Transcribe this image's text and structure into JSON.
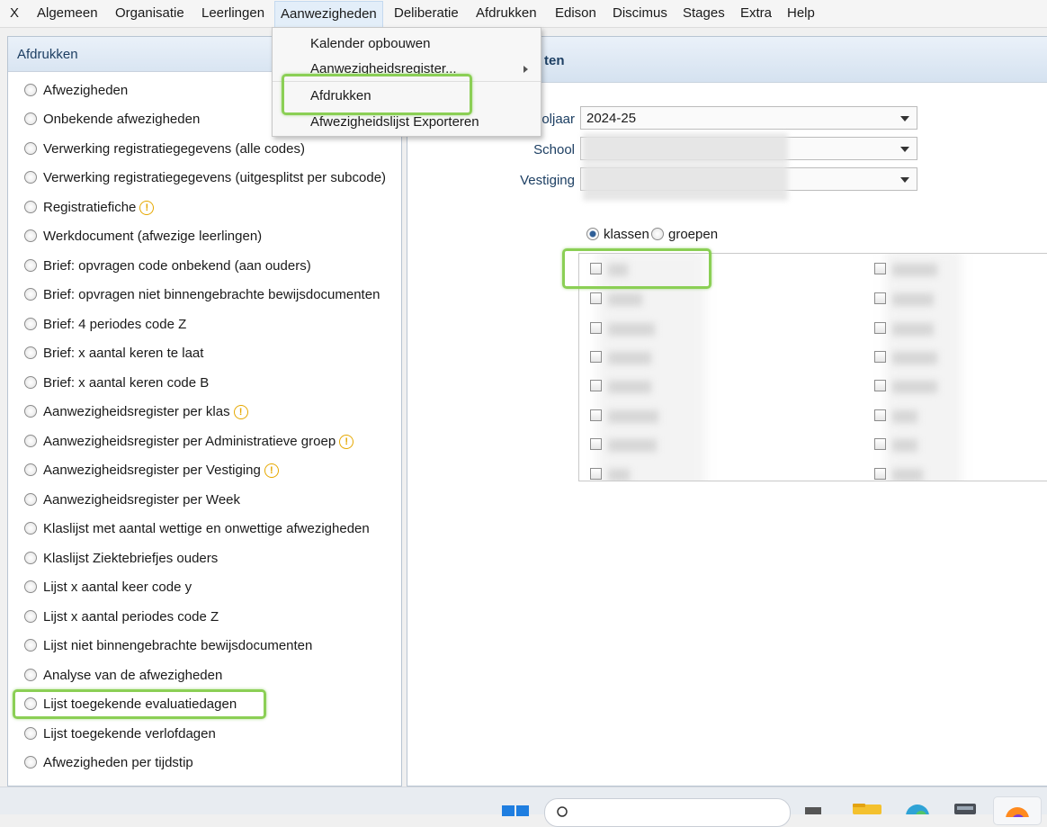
{
  "menubar": {
    "items": [
      "X",
      "Algemeen",
      "Organisatie",
      "Leerlingen",
      "Aanwezigheden",
      "Deliberatie",
      "Afdrukken",
      "Edison",
      "Discimus",
      "Stages",
      "Extra",
      "Help"
    ],
    "active": "Aanwezigheden"
  },
  "dropdown": {
    "items": [
      "Kalender opbouwen",
      "Aanwezigheidsregister...",
      "Afdrukken",
      "Afwezigheidslijst Exporteren"
    ]
  },
  "left_panel": {
    "title": "Afdrukken",
    "options": [
      {
        "label": "Afwezigheden",
        "warning": false
      },
      {
        "label": "Onbekende afwezigheden",
        "warning": false
      },
      {
        "label": "Verwerking registratiegegevens (alle codes)",
        "warning": false
      },
      {
        "label": "Verwerking registratiegegevens (uitgesplitst per subcode)",
        "warning": false
      },
      {
        "label": "Registratiefiche",
        "warning": true
      },
      {
        "label": "Werkdocument (afwezige leerlingen)",
        "warning": false
      },
      {
        "label": "Brief: opvragen code onbekend (aan ouders)",
        "warning": false
      },
      {
        "label": "Brief: opvragen niet binnengebrachte bewijsdocumenten",
        "warning": false
      },
      {
        "label": "Brief: 4 periodes code Z",
        "warning": false
      },
      {
        "label": "Brief: x aantal keren te laat",
        "warning": false
      },
      {
        "label": "Brief: x aantal keren code B",
        "warning": false
      },
      {
        "label": "Aanwezigheidsregister per klas",
        "warning": true
      },
      {
        "label": "Aanwezigheidsregister per Administratieve groep",
        "warning": true
      },
      {
        "label": "Aanwezigheidsregister per Vestiging",
        "warning": true
      },
      {
        "label": "Aanwezigheidsregister per Week",
        "warning": false
      },
      {
        "label": "Klaslijst met aantal wettige en onwettige afwezigheden",
        "warning": false
      },
      {
        "label": "Klaslijst Ziektebriefjes ouders",
        "warning": false
      },
      {
        "label": "Lijst x aantal keer code y",
        "warning": false
      },
      {
        "label": "Lijst x aantal periodes code Z",
        "warning": false
      },
      {
        "label": "Lijst niet binnengebrachte bewijsdocumenten",
        "warning": false
      },
      {
        "label": "Analyse van de afwezigheden",
        "warning": false
      },
      {
        "label": "Lijst toegekende evaluatiedagen",
        "warning": false
      },
      {
        "label": "Lijst toegekende verlofdagen",
        "warning": false
      },
      {
        "label": "Afwezigheden per tijdstip",
        "warning": false
      }
    ]
  },
  "right_panel": {
    "title_fragment": "ten",
    "fields": {
      "schooljaar_label": "oljaar",
      "schooljaar_value": "2024-25",
      "school_label": "School",
      "vestiging_label": "Vestiging"
    },
    "toggle": {
      "klassen": "klassen",
      "groepen": "groepen",
      "selected": "klassen"
    }
  },
  "colors": {
    "highlight": "#8bcf55",
    "header_text": "#1d3f63",
    "warning": "#e6a800"
  },
  "icons": [
    "warning-icon",
    "submenu-arrow-icon",
    "dropdown-arrow-icon",
    "windows-start-icon",
    "search-icon",
    "file-explorer-icon",
    "edge-icon",
    "calculator-icon",
    "firefox-icon"
  ]
}
